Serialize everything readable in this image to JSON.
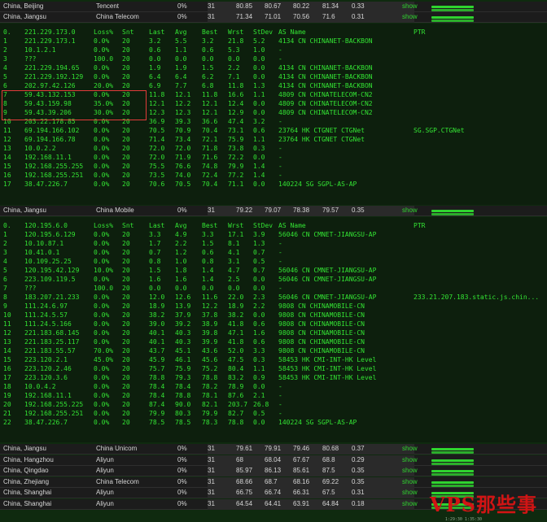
{
  "rows_top": [
    {
      "region": "China, Beijing",
      "isp": "Tencent",
      "loss": "0%",
      "snt": "31",
      "last": "80.85",
      "avg": "80.67",
      "best": "80.22",
      "wrst": "81.34",
      "stdev": "0.33",
      "show": "show"
    },
    {
      "region": "China, Jiangsu",
      "isp": "China Telecom",
      "loss": "0%",
      "snt": "31",
      "last": "71.34",
      "avg": "71.01",
      "best": "70.56",
      "wrst": "71.6",
      "stdev": "0.31",
      "show": "show"
    }
  ],
  "trace1": {
    "header": {
      "idx": "0.",
      "host": "221.229.173.0",
      "loss": "Loss%",
      "snt": "Snt",
      "last": "Last",
      "avg": "Avg",
      "best": "Best",
      "wrst": "Wrst",
      "stdev": "StDev",
      "asn": "AS Name",
      "ptr": "PTR"
    },
    "hops": [
      {
        "idx": "1",
        "host": "221.229.173.1",
        "loss": "0.0%",
        "snt": "20",
        "last": "3.2",
        "avg": "5.5",
        "best": "3.2",
        "wrst": "21.8",
        "stdev": "5.2",
        "asn": "4134  CN CHINANET-BACKBON",
        "ptr": ""
      },
      {
        "idx": "2",
        "host": "10.1.2.1",
        "loss": "0.0%",
        "snt": "20",
        "last": "0.6",
        "avg": "1.1",
        "best": "0.6",
        "wrst": "5.3",
        "stdev": "1.0",
        "asn": "-",
        "ptr": ""
      },
      {
        "idx": "3",
        "host": "???",
        "loss": "100.0",
        "snt": "20",
        "last": "0.0",
        "avg": "0.0",
        "best": "0.0",
        "wrst": "0.0",
        "stdev": "0.0",
        "asn": "-",
        "ptr": ""
      },
      {
        "idx": "4",
        "host": "221.229.194.65",
        "loss": "0.0%",
        "snt": "20",
        "last": "1.9",
        "avg": "1.9",
        "best": "1.5",
        "wrst": "2.2",
        "stdev": "0.0",
        "asn": "4134  CN CHINANET-BACKBON",
        "ptr": ""
      },
      {
        "idx": "5",
        "host": "221.229.192.129",
        "loss": "0.0%",
        "snt": "20",
        "last": "6.4",
        "avg": "6.4",
        "best": "6.2",
        "wrst": "7.1",
        "stdev": "0.0",
        "asn": "4134  CN CHINANET-BACKBON",
        "ptr": ""
      },
      {
        "idx": "6",
        "host": "202.97.42.126",
        "loss": "20.0%",
        "snt": "20",
        "last": "6.9",
        "avg": "7.7",
        "best": "6.8",
        "wrst": "11.8",
        "stdev": "1.3",
        "asn": "4134  CN CHINANET-BACKBON",
        "ptr": ""
      },
      {
        "idx": "7",
        "host": "59.43.132.153",
        "loss": "0.0%",
        "snt": "20",
        "last": "11.8",
        "avg": "12.1",
        "best": "11.8",
        "wrst": "16.6",
        "stdev": "1.1",
        "asn": "4809  CN CHINATELECOM-CN2",
        "ptr": ""
      },
      {
        "idx": "8",
        "host": "59.43.159.98",
        "loss": "35.0%",
        "snt": "20",
        "last": "12.1",
        "avg": "12.2",
        "best": "12.1",
        "wrst": "12.4",
        "stdev": "0.0",
        "asn": "4809  CN CHINATELECOM-CN2",
        "ptr": ""
      },
      {
        "idx": "9",
        "host": "59.43.39.206",
        "loss": "30.0%",
        "snt": "20",
        "last": "12.3",
        "avg": "12.3",
        "best": "12.1",
        "wrst": "12.9",
        "stdev": "0.0",
        "asn": "4809  CN CHINATELECOM-CN2",
        "ptr": ""
      },
      {
        "idx": "10",
        "host": "203.22.178.85",
        "loss": "0.0%",
        "snt": "20",
        "last": "36.9",
        "avg": "39.3",
        "best": "36.6",
        "wrst": "47.4",
        "stdev": "3.2",
        "asn": "-",
        "ptr": ""
      },
      {
        "idx": "11",
        "host": "69.194.166.102",
        "loss": "0.0%",
        "snt": "20",
        "last": "70.5",
        "avg": "70.9",
        "best": "70.4",
        "wrst": "73.1",
        "stdev": "0.6",
        "asn": "23764 HK CTGNET CTGNet",
        "ptr": "SG.SGP.CTGNet"
      },
      {
        "idx": "12",
        "host": "69.194.166.78",
        "loss": "0.0%",
        "snt": "20",
        "last": "71.4",
        "avg": "73.4",
        "best": "72.1",
        "wrst": "75.9",
        "stdev": "1.1",
        "asn": "23764 HK CTGNET CTGNet",
        "ptr": ""
      },
      {
        "idx": "13",
        "host": "10.0.2.2",
        "loss": "0.0%",
        "snt": "20",
        "last": "72.0",
        "avg": "72.0",
        "best": "71.8",
        "wrst": "73.8",
        "stdev": "0.3",
        "asn": "-",
        "ptr": ""
      },
      {
        "idx": "14",
        "host": "192.168.11.1",
        "loss": "0.0%",
        "snt": "20",
        "last": "72.0",
        "avg": "71.9",
        "best": "71.6",
        "wrst": "72.2",
        "stdev": "0.0",
        "asn": "-",
        "ptr": ""
      },
      {
        "idx": "15",
        "host": "192.168.255.255",
        "loss": "0.0%",
        "snt": "20",
        "last": "75.5",
        "avg": "76.6",
        "best": "74.8",
        "wrst": "79.9",
        "stdev": "1.4",
        "asn": "-",
        "ptr": ""
      },
      {
        "idx": "16",
        "host": "192.168.255.251",
        "loss": "0.0%",
        "snt": "20",
        "last": "73.5",
        "avg": "74.0",
        "best": "72.4",
        "wrst": "77.2",
        "stdev": "1.4",
        "asn": "-",
        "ptr": ""
      },
      {
        "idx": "17",
        "host": "38.47.226.7",
        "loss": "0.0%",
        "snt": "20",
        "last": "70.6",
        "avg": "70.5",
        "best": "70.4",
        "wrst": "71.1",
        "stdev": "0.0",
        "asn": "140224 SG SGPL-AS-AP",
        "ptr": ""
      }
    ]
  },
  "row_mid": {
    "region": "China, Jiangsu",
    "isp": "China Mobile",
    "loss": "0%",
    "snt": "31",
    "last": "79.22",
    "avg": "79.07",
    "best": "78.38",
    "wrst": "79.57",
    "stdev": "0.35",
    "show": "show"
  },
  "trace2": {
    "header": {
      "idx": "0.",
      "host": "120.195.6.0",
      "loss": "Loss%",
      "snt": "Snt",
      "last": "Last",
      "avg": "Avg",
      "best": "Best",
      "wrst": "Wrst",
      "stdev": "StDev",
      "asn": "AS Name",
      "ptr": "PTR"
    },
    "hops": [
      {
        "idx": "1",
        "host": "120.195.6.129",
        "loss": "0.0%",
        "snt": "20",
        "last": "3.3",
        "avg": "4.9",
        "best": "3.3",
        "wrst": "17.1",
        "stdev": "3.9",
        "asn": "56046 CN CMNET-JIANGSU-AP",
        "ptr": ""
      },
      {
        "idx": "2",
        "host": "10.10.87.1",
        "loss": "0.0%",
        "snt": "20",
        "last": "1.7",
        "avg": "2.2",
        "best": "1.5",
        "wrst": "8.1",
        "stdev": "1.3",
        "asn": "-",
        "ptr": ""
      },
      {
        "idx": "3",
        "host": "10.41.0.1",
        "loss": "0.0%",
        "snt": "20",
        "last": "0.7",
        "avg": "1.2",
        "best": "0.6",
        "wrst": "4.1",
        "stdev": "0.7",
        "asn": "-",
        "ptr": ""
      },
      {
        "idx": "4",
        "host": "10.109.25.25",
        "loss": "0.0%",
        "snt": "20",
        "last": "0.8",
        "avg": "1.0",
        "best": "0.8",
        "wrst": "3.1",
        "stdev": "0.5",
        "asn": "-",
        "ptr": ""
      },
      {
        "idx": "5",
        "host": "120.195.42.129",
        "loss": "10.0%",
        "snt": "20",
        "last": "1.5",
        "avg": "1.8",
        "best": "1.4",
        "wrst": "4.7",
        "stdev": "0.7",
        "asn": "56046 CN CMNET-JIANGSU-AP",
        "ptr": ""
      },
      {
        "idx": "6",
        "host": "223.109.119.5",
        "loss": "0.0%",
        "snt": "20",
        "last": "1.6",
        "avg": "1.6",
        "best": "1.4",
        "wrst": "2.5",
        "stdev": "0.0",
        "asn": "56046 CN CMNET-JIANGSU-AP",
        "ptr": ""
      },
      {
        "idx": "7",
        "host": "???",
        "loss": "100.0",
        "snt": "20",
        "last": "0.0",
        "avg": "0.0",
        "best": "0.0",
        "wrst": "0.0",
        "stdev": "0.0",
        "asn": "-",
        "ptr": ""
      },
      {
        "idx": "8",
        "host": "183.207.21.233",
        "loss": "0.0%",
        "snt": "20",
        "last": "12.0",
        "avg": "12.6",
        "best": "11.6",
        "wrst": "22.0",
        "stdev": "2.3",
        "asn": "56046 CN CMNET-JIANGSU-AP",
        "ptr": "233.21.207.183.static.js.chin..."
      },
      {
        "idx": "9",
        "host": "111.24.6.97",
        "loss": "0.0%",
        "snt": "20",
        "last": "18.9",
        "avg": "13.9",
        "best": "12.2",
        "wrst": "18.9",
        "stdev": "2.2",
        "asn": "9808  CN CHINAMOBILE-CN",
        "ptr": ""
      },
      {
        "idx": "10",
        "host": "111.24.5.57",
        "loss": "0.0%",
        "snt": "20",
        "last": "38.2",
        "avg": "37.9",
        "best": "37.8",
        "wrst": "38.2",
        "stdev": "0.0",
        "asn": "9808  CN CHINAMOBILE-CN",
        "ptr": ""
      },
      {
        "idx": "11",
        "host": "111.24.5.166",
        "loss": "0.0%",
        "snt": "20",
        "last": "39.0",
        "avg": "39.2",
        "best": "38.9",
        "wrst": "41.8",
        "stdev": "0.6",
        "asn": "9808  CN CHINAMOBILE-CN",
        "ptr": ""
      },
      {
        "idx": "12",
        "host": "221.183.68.145",
        "loss": "0.0%",
        "snt": "20",
        "last": "40.1",
        "avg": "40.3",
        "best": "39.8",
        "wrst": "47.1",
        "stdev": "1.6",
        "asn": "9808  CN CHINAMOBILE-CN",
        "ptr": ""
      },
      {
        "idx": "13",
        "host": "221.183.25.117",
        "loss": "0.0%",
        "snt": "20",
        "last": "40.1",
        "avg": "40.3",
        "best": "39.9",
        "wrst": "41.8",
        "stdev": "0.6",
        "asn": "9808  CN CHINAMOBILE-CN",
        "ptr": ""
      },
      {
        "idx": "14",
        "host": "221.183.55.57",
        "loss": "70.0%",
        "snt": "20",
        "last": "43.7",
        "avg": "45.1",
        "best": "43.6",
        "wrst": "52.0",
        "stdev": "3.3",
        "asn": "9808  CN CHINAMOBILE-CN",
        "ptr": ""
      },
      {
        "idx": "15",
        "host": "223.120.2.1",
        "loss": "45.0%",
        "snt": "20",
        "last": "45.9",
        "avg": "46.1",
        "best": "45.6",
        "wrst": "47.5",
        "stdev": "0.3",
        "asn": "58453 HK CMI-INT-HK Level",
        "ptr": ""
      },
      {
        "idx": "16",
        "host": "223.120.2.46",
        "loss": "0.0%",
        "snt": "20",
        "last": "75.7",
        "avg": "75.9",
        "best": "75.2",
        "wrst": "80.4",
        "stdev": "1.1",
        "asn": "58453 HK CMI-INT-HK Level",
        "ptr": ""
      },
      {
        "idx": "17",
        "host": "223.120.3.6",
        "loss": "0.0%",
        "snt": "20",
        "last": "78.8",
        "avg": "79.3",
        "best": "78.8",
        "wrst": "83.2",
        "stdev": "0.9",
        "asn": "58453 HK CMI-INT-HK Level",
        "ptr": ""
      },
      {
        "idx": "18",
        "host": "10.0.4.2",
        "loss": "0.0%",
        "snt": "20",
        "last": "78.4",
        "avg": "78.4",
        "best": "78.2",
        "wrst": "78.9",
        "stdev": "0.0",
        "asn": "-",
        "ptr": ""
      },
      {
        "idx": "19",
        "host": "192.168.11.1",
        "loss": "0.0%",
        "snt": "20",
        "last": "78.4",
        "avg": "78.8",
        "best": "78.1",
        "wrst": "87.6",
        "stdev": "2.1",
        "asn": "-",
        "ptr": ""
      },
      {
        "idx": "20",
        "host": "192.168.255.225",
        "loss": "0.0%",
        "snt": "20",
        "last": "87.4",
        "avg": "90.0",
        "best": "82.1",
        "wrst": "203.7",
        "stdev": "26.8",
        "asn": "-",
        "ptr": ""
      },
      {
        "idx": "21",
        "host": "192.168.255.251",
        "loss": "0.0%",
        "snt": "20",
        "last": "79.9",
        "avg": "80.3",
        "best": "79.9",
        "wrst": "82.7",
        "stdev": "0.5",
        "asn": "-",
        "ptr": ""
      },
      {
        "idx": "22",
        "host": "38.47.226.7",
        "loss": "0.0%",
        "snt": "20",
        "last": "78.5",
        "avg": "78.5",
        "best": "78.3",
        "wrst": "78.8",
        "stdev": "0.0",
        "asn": "140224 SG SGPL-AS-AP",
        "ptr": ""
      }
    ]
  },
  "rows_bottom": [
    {
      "region": "China, Jiangsu",
      "isp": "China Unicom",
      "loss": "0%",
      "snt": "31",
      "last": "79.61",
      "avg": "79.91",
      "best": "79.46",
      "wrst": "80.68",
      "stdev": "0.37",
      "show": "show"
    },
    {
      "region": "China, Hangzhou",
      "isp": "Aliyun",
      "loss": "0%",
      "snt": "31",
      "last": "68",
      "avg": "68.04",
      "best": "67.67",
      "wrst": "68.8",
      "stdev": "0.29",
      "show": "show"
    },
    {
      "region": "China, Qingdao",
      "isp": "Aliyun",
      "loss": "0%",
      "snt": "31",
      "last": "85.97",
      "avg": "86.13",
      "best": "85.61",
      "wrst": "87.5",
      "stdev": "0.35",
      "show": "show"
    },
    {
      "region": "China, Zhejiang",
      "isp": "China Telecom",
      "loss": "0%",
      "snt": "31",
      "last": "68.66",
      "avg": "68.7",
      "best": "68.16",
      "wrst": "69.22",
      "stdev": "0.35",
      "show": "show"
    },
    {
      "region": "China, Shanghai",
      "isp": "Aliyun",
      "loss": "0%",
      "snt": "31",
      "last": "66.75",
      "avg": "66.74",
      "best": "66.31",
      "wrst": "67.5",
      "stdev": "0.31",
      "show": "show"
    },
    {
      "region": "China, Shanghai",
      "isp": "Aliyun",
      "loss": "0%",
      "snt": "31",
      "last": "64.54",
      "avg": "64.41",
      "best": "63.91",
      "wrst": "64.84",
      "stdev": "0.18",
      "show": "show"
    }
  ],
  "watermark": "VPS那些事",
  "watermark_sub": "1:29:30        1:35:30"
}
